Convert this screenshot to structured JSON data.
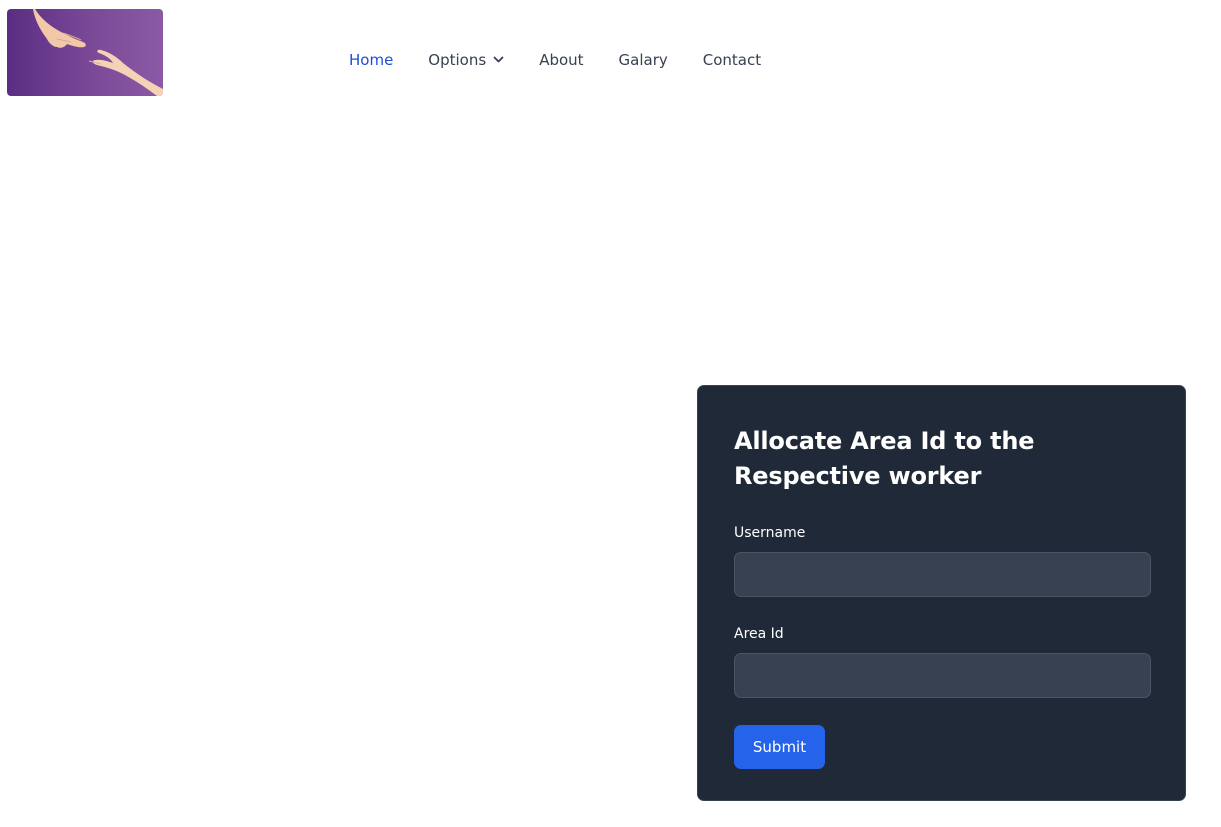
{
  "nav": {
    "items": [
      {
        "label": "Home",
        "active": true
      },
      {
        "label": "Options",
        "has_dropdown": true
      },
      {
        "label": "About"
      },
      {
        "label": "Galary"
      },
      {
        "label": "Contact"
      }
    ],
    "dropdown_icon": "chevron-down-icon",
    "active_color": "#1d4ed8"
  },
  "logo": {
    "icon": "reaching-hands-image",
    "background": "#6b3a8f"
  },
  "form": {
    "title": "Allocate Area Id to the Respective worker",
    "username_label": "Username",
    "username_value": "",
    "area_id_label": "Area Id",
    "area_id_value": "",
    "submit_label": "Submit",
    "card_color": "#1f2937",
    "input_color": "#374151",
    "button_color": "#2563eb"
  }
}
